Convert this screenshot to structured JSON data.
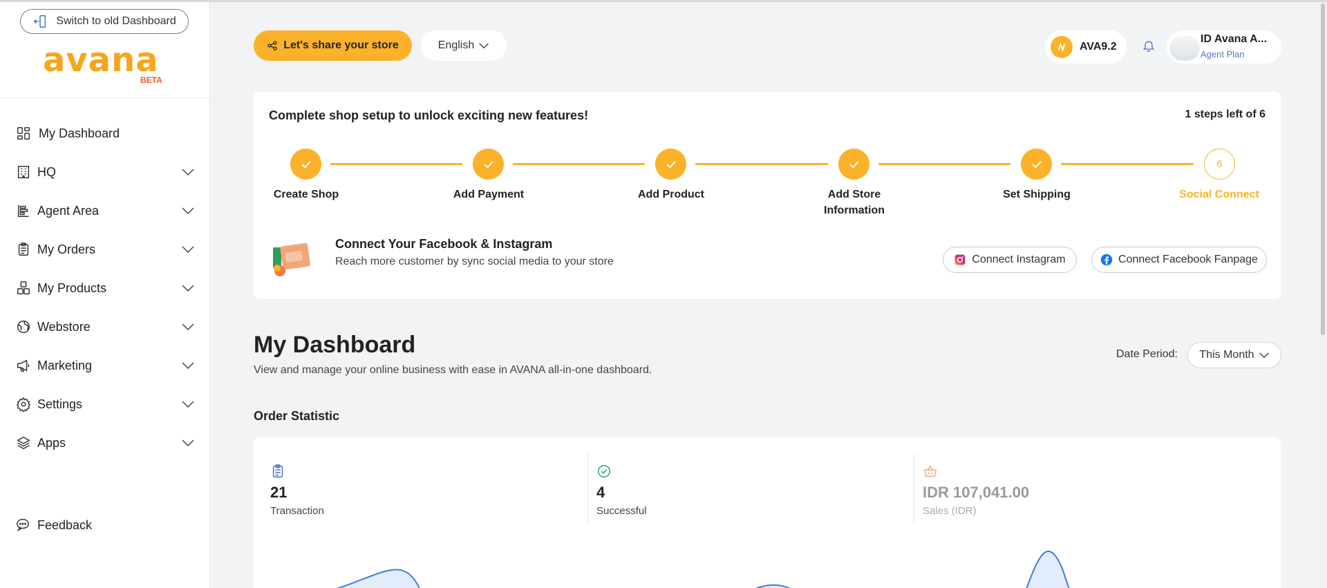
{
  "sidebar": {
    "switch_label": "Switch to old Dashboard",
    "logo_text": "avana",
    "logo_badge": "BETA",
    "menu": [
      {
        "label": "My Dashboard",
        "icon": "dashboard-grid-icon"
      },
      {
        "label": "HQ",
        "icon": "building-icon"
      },
      {
        "label": "Agent Area",
        "icon": "agent-area-icon"
      },
      {
        "label": "My Orders",
        "icon": "orders-clipboard-icon"
      },
      {
        "label": "My Products",
        "icon": "products-boxes-icon"
      },
      {
        "label": "Webstore",
        "icon": "globe-icon"
      },
      {
        "label": "Marketing",
        "icon": "megaphone-icon"
      },
      {
        "label": "Settings",
        "icon": "gear-icon"
      },
      {
        "label": "Apps",
        "icon": "layers-icon"
      }
    ],
    "feedback_label": "Feedback"
  },
  "header": {
    "share_label": "Let's share your store",
    "language": "English",
    "coin_value": "AVA9.2",
    "user_name": "ID Avana A...",
    "user_plan": "Agent Plan"
  },
  "setup": {
    "title": "Complete shop setup to unlock exciting new features!",
    "steps_left": "1 steps left of 6",
    "steps": [
      {
        "label": "Create Shop",
        "done": true
      },
      {
        "label": "Add Payment",
        "done": true
      },
      {
        "label": "Add Product",
        "done": true
      },
      {
        "label": "Add Store Information",
        "done": true
      },
      {
        "label": "Set Shipping",
        "done": true
      },
      {
        "label": "Social Connect",
        "done": false,
        "number": "6"
      }
    ],
    "connect_title": "Connect Your Facebook & Instagram",
    "connect_desc": "Reach more customer by sync social media to your store",
    "instagram_label": "Connect Instagram",
    "facebook_label": "Connect Facebook Fanpage"
  },
  "dashboard": {
    "title": "My Dashboard",
    "subtitle": "View and manage your online business with ease in AVANA all-in-one dashboard.",
    "date_label": "Date Period:",
    "date_value": "This Month",
    "order_stat_title": "Order Statistic",
    "stats": [
      {
        "value": "21",
        "label": "Transaction",
        "icon": "clipboard-list-icon"
      },
      {
        "value": "4",
        "label": "Successful",
        "icon": "check-circle-icon"
      },
      {
        "value": "IDR 107,041.00",
        "label": "Sales (IDR)",
        "icon": "basket-icon"
      }
    ]
  },
  "colors": {
    "accent": "#fbb22a",
    "background": "#f1f3f5",
    "plan_link": "#5b74c9"
  }
}
